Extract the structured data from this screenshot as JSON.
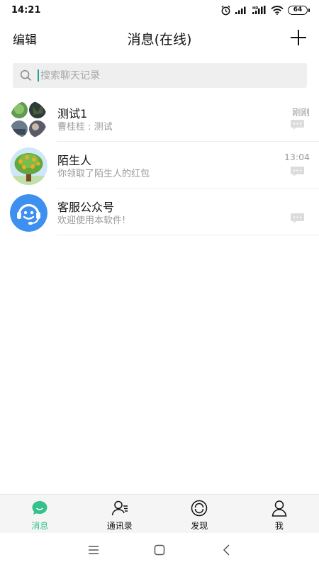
{
  "status": {
    "time": "14:21",
    "battery": "64",
    "network": "4G"
  },
  "header": {
    "edit_label": "编辑",
    "title": "消息(在线)"
  },
  "search": {
    "placeholder": "搜索聊天记录"
  },
  "conversations": [
    {
      "name": "测试1",
      "preview": "曹桂桂 : 测试",
      "time": "刚刚",
      "avatar": "group-photo-avatar"
    },
    {
      "name": "陌生人",
      "preview": "你领取了陌生人的红包",
      "time": "13:04",
      "avatar": "tree-avatar"
    },
    {
      "name": "客服公众号",
      "preview": "欢迎使用本软件!",
      "time": "",
      "avatar": "headset-avatar"
    }
  ],
  "tabs": [
    {
      "label": "消息",
      "icon": "chat-bubble-icon",
      "active": true
    },
    {
      "label": "通讯录",
      "icon": "contacts-icon",
      "active": false
    },
    {
      "label": "发现",
      "icon": "discover-icon",
      "active": false
    },
    {
      "label": "我",
      "icon": "person-icon",
      "active": false
    }
  ],
  "colors": {
    "accent": "#34c18a",
    "service_blue": "#3d8ff0"
  }
}
